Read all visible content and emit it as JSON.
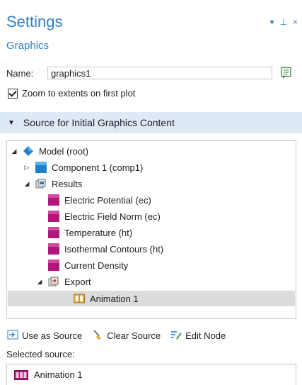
{
  "header": {
    "title": "Settings",
    "subtitle": "Graphics"
  },
  "window_controls": {
    "dropdown": "▾",
    "pin": "⊥",
    "close": "×"
  },
  "name_field": {
    "label": "Name:",
    "value": "graphics1"
  },
  "zoom_checkbox": {
    "label": "Zoom to extents on first plot",
    "checked": true
  },
  "section": {
    "title": "Source for Initial Graphics Content"
  },
  "tree": {
    "model": "Model (root)",
    "component": "Component 1 (comp1)",
    "results": "Results",
    "items": [
      "Electric Potential (ec)",
      "Electric Field Norm (ec)",
      "Temperature (ht)",
      "Isothermal Contours (ht)",
      "Current Density"
    ],
    "export": "Export",
    "animation": "Animation 1"
  },
  "actions": {
    "use_as_source": "Use as Source",
    "clear_source": "Clear Source",
    "edit_node": "Edit Node"
  },
  "selected": {
    "label": "Selected source:",
    "value": "Animation 1"
  },
  "colors": {
    "accent": "#2f7fc1",
    "header_bg": "#dfe9f5",
    "cube": "#b0177a"
  }
}
